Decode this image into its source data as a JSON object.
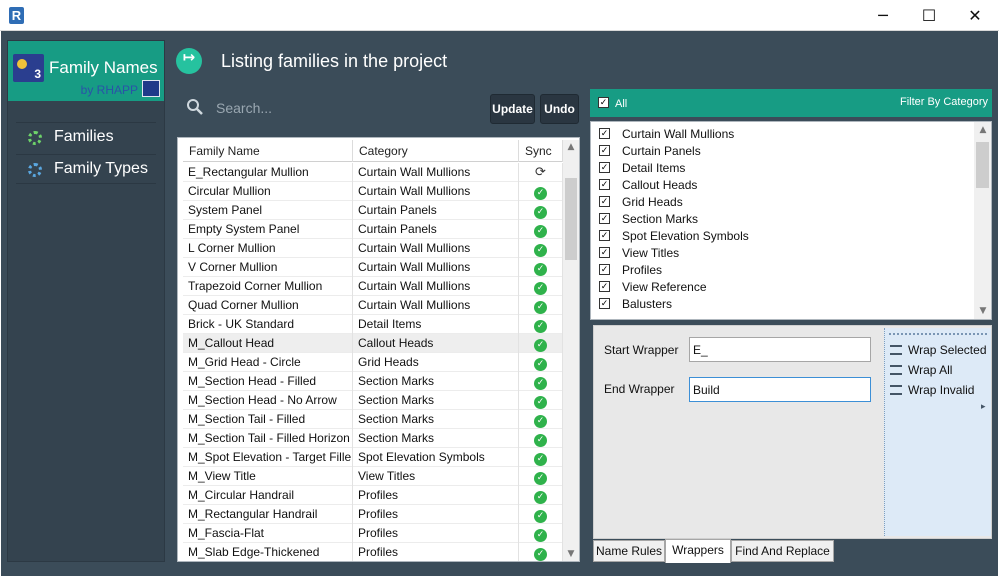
{
  "titlebar": {
    "logo_letter": "R",
    "minimize": "─",
    "maximize": "☐",
    "close": "✕"
  },
  "sidebar": {
    "brand_title": "Family Names",
    "brand_sub": "by RHAPP",
    "items": [
      {
        "label": "Families",
        "icon": "spinner-green-icon"
      },
      {
        "label": "Family Types",
        "icon": "spinner-blue-icon"
      }
    ]
  },
  "header": {
    "title": "Listing families in the project",
    "arrow": "↦"
  },
  "search": {
    "placeholder": "Search..."
  },
  "toolbar": {
    "update_label": "Update",
    "undo_label": "Undo"
  },
  "table": {
    "columns": [
      "Family Name",
      "Category",
      "Sync"
    ],
    "rows": [
      {
        "name": "E_Rectangular Mullion",
        "category": "Curtain Wall Mullions",
        "sync": "pending"
      },
      {
        "name": "Circular Mullion",
        "category": "Curtain Wall Mullions",
        "sync": "ok"
      },
      {
        "name": "System Panel",
        "category": "Curtain Panels",
        "sync": "ok"
      },
      {
        "name": "Empty System Panel",
        "category": "Curtain Panels",
        "sync": "ok"
      },
      {
        "name": "L Corner Mullion",
        "category": "Curtain Wall Mullions",
        "sync": "ok"
      },
      {
        "name": "V Corner Mullion",
        "category": "Curtain Wall Mullions",
        "sync": "ok"
      },
      {
        "name": "Trapezoid Corner Mullion",
        "category": "Curtain Wall Mullions",
        "sync": "ok"
      },
      {
        "name": "Quad Corner Mullion",
        "category": "Curtain Wall Mullions",
        "sync": "ok"
      },
      {
        "name": "Brick - UK Standard",
        "category": "Detail Items",
        "sync": "ok"
      },
      {
        "name": "M_Callout Head",
        "category": "Callout Heads",
        "sync": "ok",
        "selected": true
      },
      {
        "name": "M_Grid Head - Circle",
        "category": "Grid Heads",
        "sync": "ok"
      },
      {
        "name": "M_Section Head - Filled",
        "category": "Section Marks",
        "sync": "ok"
      },
      {
        "name": "M_Section Head - No Arrow",
        "category": "Section Marks",
        "sync": "ok"
      },
      {
        "name": "M_Section Tail - Filled",
        "category": "Section Marks",
        "sync": "ok"
      },
      {
        "name": "M_Section Tail - Filled Horizon",
        "category": "Section Marks",
        "sync": "ok"
      },
      {
        "name": "M_Spot Elevation - Target Fille",
        "category": "Spot Elevation Symbols",
        "sync": "ok"
      },
      {
        "name": "M_View Title",
        "category": "View Titles",
        "sync": "ok"
      },
      {
        "name": "M_Circular Handrail",
        "category": "Profiles",
        "sync": "ok"
      },
      {
        "name": "M_Rectangular Handrail",
        "category": "Profiles",
        "sync": "ok"
      },
      {
        "name": "M_Fascia-Flat",
        "category": "Profiles",
        "sync": "ok"
      },
      {
        "name": "M_Slab Edge-Thickened",
        "category": "Profiles",
        "sync": "ok"
      }
    ]
  },
  "filter": {
    "all_label": "All",
    "title": "Filter By Category",
    "categories": [
      "Curtain Wall Mullions",
      "Curtain Panels",
      "Detail Items",
      "Callout Heads",
      "Grid Heads",
      "Section Marks",
      "Spot Elevation Symbols",
      "View Titles",
      "Profiles",
      "View Reference",
      "Balusters"
    ]
  },
  "wrappers": {
    "start_label": "Start Wrapper",
    "start_value": "E_",
    "end_label": "End Wrapper",
    "end_value": "Build",
    "actions": [
      "Wrap Selected",
      "Wrap All",
      "Wrap Invalid"
    ]
  },
  "tabs": [
    "Name Rules",
    "Wrappers",
    "Find And Replace"
  ],
  "colors": {
    "accent": "#179c84",
    "background": "#3b4c59",
    "ok": "#2fb24b"
  }
}
